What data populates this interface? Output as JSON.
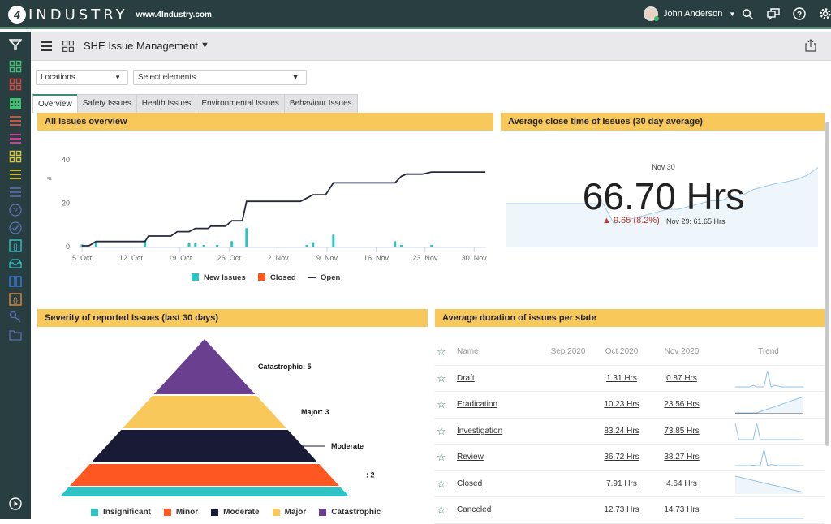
{
  "topbar": {
    "logo_mark": "4",
    "logo_text": "INDUSTRY",
    "url": "www.4Industry.com",
    "user_name": "John Anderson"
  },
  "subheader": {
    "title": "SHE Issue Management"
  },
  "filters": {
    "locations": "Locations",
    "elements": "Select elements"
  },
  "tabs": [
    {
      "label": "Overview",
      "active": true
    },
    {
      "label": "Safety Issues"
    },
    {
      "label": "Health Issues"
    },
    {
      "label": "Environmental Issues"
    },
    {
      "label": "Behaviour Issues"
    }
  ],
  "panels": {
    "overview_title": "All Issues overview",
    "close_time_title": "Average close time of Issues (30 day average)",
    "severity_title": "Severity of reported Issues (last 30 days)",
    "duration_title": "Average duration of issues per state"
  },
  "close_time": {
    "date": "Nov 30",
    "value": "66.70 Hrs",
    "delta": "▲ 9.65 (8.2%)",
    "previous": "Nov 29: 61.65 Hrs",
    "accent_color": "#c0392b"
  },
  "duration_table": {
    "headers": [
      "Name",
      "Sep 2020",
      "Oct 2020",
      "Nov 2020",
      "Trend"
    ],
    "rows": [
      {
        "name": "Draft",
        "sep": "",
        "oct": "1.31 Hrs",
        "nov": "0.87 Hrs"
      },
      {
        "name": "Eradication",
        "sep": "",
        "oct": "10.23 Hrs",
        "nov": "23.56 Hrs"
      },
      {
        "name": "Investigation",
        "sep": "",
        "oct": "83.24 Hrs",
        "nov": "73.85 Hrs"
      },
      {
        "name": "Review",
        "sep": "",
        "oct": "36.72 Hrs",
        "nov": "38.27 Hrs"
      },
      {
        "name": "Closed",
        "sep": "",
        "oct": "7.91 Hrs",
        "nov": "4.64 Hrs"
      },
      {
        "name": "Canceled",
        "sep": "",
        "oct": "12.73 Hrs",
        "nov": "14.73 Hrs"
      }
    ]
  },
  "chart_data": [
    {
      "type": "line",
      "title": "All Issues overview",
      "ylabel": "#",
      "ylim": [
        0,
        40
      ],
      "yticks": [
        0,
        20,
        40
      ],
      "xticks": [
        "5. Oct",
        "12. Oct",
        "19. Oct",
        "26. Oct",
        "2. Nov",
        "9. Nov",
        "16. Nov",
        "23. Nov",
        "30. Nov"
      ],
      "x_unit": "days since 5. Oct",
      "legend": [
        "New Issues",
        "Closed",
        "Open"
      ],
      "legend_position": "bottom",
      "colors": {
        "New Issues": "#2ec4c6",
        "Closed": "#ff5722",
        "Open": "#262840"
      },
      "series": [
        {
          "name": "Open",
          "kind": "line",
          "points": [
            [
              0,
              0
            ],
            [
              1,
              0
            ],
            [
              2,
              2
            ],
            [
              6,
              2
            ],
            [
              9,
              2
            ],
            [
              9.5,
              4.5
            ],
            [
              12.7,
              4.5
            ],
            [
              13.6,
              6.5
            ],
            [
              15.3,
              6.5
            ],
            [
              16.2,
              8
            ],
            [
              18,
              8
            ],
            [
              18.4,
              9
            ],
            [
              20.5,
              9
            ],
            [
              21.4,
              11.5
            ],
            [
              22.9,
              11.5
            ],
            [
              23.5,
              20.5
            ],
            [
              31.2,
              20.5
            ],
            [
              32.1,
              22
            ],
            [
              33,
              23.5
            ],
            [
              34.8,
              23.5
            ],
            [
              35.9,
              29
            ],
            [
              44.7,
              29
            ],
            [
              45.6,
              32
            ],
            [
              46.3,
              33
            ],
            [
              48.6,
              33
            ],
            [
              49.9,
              34
            ],
            [
              57.6,
              34
            ]
          ]
        },
        {
          "name": "New Issues",
          "kind": "column",
          "points": [
            [
              0,
              1
            ],
            [
              2,
              2
            ],
            [
              9,
              3
            ],
            [
              15.3,
              1.5
            ],
            [
              16.2,
              1.5
            ],
            [
              17.4,
              0.8
            ],
            [
              19.3,
              0.8
            ],
            [
              21.4,
              2.5
            ],
            [
              23.5,
              8.5
            ],
            [
              32.1,
              0.8
            ],
            [
              33,
              2
            ],
            [
              35.9,
              5.5
            ],
            [
              44.7,
              2.5
            ],
            [
              45.6,
              0.8
            ],
            [
              49.9,
              0.8
            ]
          ]
        },
        {
          "name": "Closed",
          "kind": "column",
          "points": []
        }
      ]
    },
    {
      "type": "area",
      "title": "Average close time of Issues (30 day average)",
      "series": [
        {
          "name": "Avg close time",
          "values": [
            54,
            54,
            54,
            54,
            54,
            54,
            54,
            54,
            54,
            54,
            47,
            48,
            49,
            50,
            51,
            52,
            52,
            53,
            54,
            55,
            55,
            57,
            57,
            59,
            60,
            61,
            61.65,
            62.5,
            64,
            66.7
          ]
        }
      ]
    },
    {
      "type": "pyramid",
      "title": "Severity of reported Issues (last 30 days)",
      "categories": [
        "Insignificant",
        "Minor",
        "Moderate",
        "Major",
        "Catastrophic"
      ],
      "labels": [
        "",
        ": 2",
        "Moderate",
        "Major: 3",
        "Catastrophic: 5"
      ],
      "colors": [
        "#2ec4c6",
        "#ff5722",
        "#191a36",
        "#f8c85a",
        "#6a3f8f"
      ],
      "legend_position": "bottom"
    },
    {
      "type": "line",
      "title": "Trend sparklines",
      "series": [
        {
          "name": "Draft",
          "values": [
            0,
            0,
            0,
            0,
            0,
            1,
            0,
            0,
            0,
            10,
            0,
            1,
            0.5,
            0,
            0,
            0,
            0,
            0,
            0,
            0
          ]
        },
        {
          "name": "Eradication",
          "values": [
            0,
            0,
            0,
            0,
            0,
            0,
            0,
            1,
            2,
            3,
            4,
            5,
            6,
            7,
            8,
            9,
            10,
            11,
            12,
            13
          ]
        },
        {
          "name": "Investigation",
          "values": [
            10,
            0,
            0,
            0,
            0,
            0,
            10,
            0,
            0,
            0,
            0,
            0,
            0,
            0,
            0,
            0,
            0,
            0,
            0,
            0
          ]
        },
        {
          "name": "Review",
          "values": [
            0,
            0,
            0,
            0,
            0,
            0.3,
            0,
            0,
            10,
            0,
            0.7,
            0.3,
            0,
            0,
            0,
            0,
            0,
            0,
            0,
            0
          ]
        },
        {
          "name": "Closed",
          "values": [
            10,
            9,
            8,
            7,
            6,
            5,
            4,
            3,
            2,
            1,
            0
          ]
        },
        {
          "name": "Canceled",
          "values": [
            0,
            0,
            0,
            0,
            0,
            0,
            0,
            0,
            0,
            0
          ]
        }
      ]
    }
  ]
}
